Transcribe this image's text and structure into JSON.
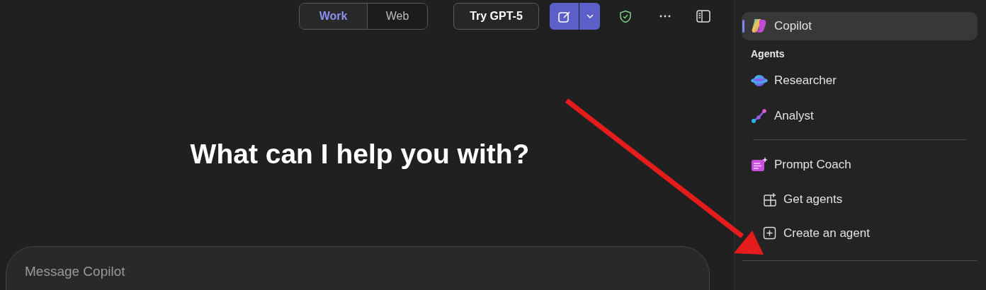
{
  "mode_toggle": [
    {
      "label": "Work",
      "selected": true
    },
    {
      "label": "Web",
      "selected": false
    }
  ],
  "toolbar": {
    "try_button": "Try GPT-5"
  },
  "heading": "What can I help you with?",
  "composer": {
    "placeholder": "Message Copilot"
  },
  "sidebar": {
    "items": [
      {
        "kind": "app",
        "label": "Copilot",
        "selected": true
      },
      {
        "kind": "header",
        "label": "Agents"
      },
      {
        "kind": "agent",
        "label": "Researcher",
        "selected": false
      },
      {
        "kind": "agent",
        "label": "Analyst",
        "selected": false
      },
      {
        "kind": "divider"
      },
      {
        "kind": "agent",
        "label": "Prompt Coach",
        "selected": false
      },
      {
        "kind": "action",
        "label": "Get agents"
      },
      {
        "kind": "action",
        "label": "Create an agent"
      },
      {
        "kind": "divider-wide"
      }
    ]
  },
  "annotation": {
    "kind": "arrow"
  }
}
